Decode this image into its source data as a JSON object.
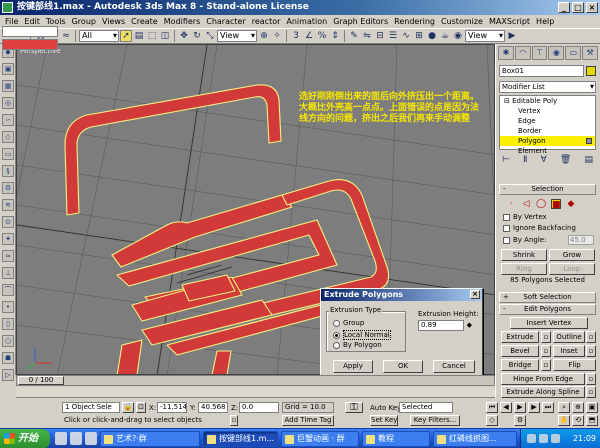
{
  "window": {
    "title": "按键部线1.max - Autodesk 3ds Max 8  - Stand-alone License"
  },
  "menu": [
    "File",
    "Edit",
    "Tools",
    "Group",
    "Views",
    "Create",
    "Modifiers",
    "Character",
    "reactor",
    "Animation",
    "Graph Editors",
    "Rendering",
    "Customize",
    "MAXScript",
    "Help"
  ],
  "toolbar": {
    "selection_filter": "All",
    "ref_coord": "View",
    "view_right": "View"
  },
  "viewport": {
    "label": "Perspective",
    "annotation": "选好刚刚倒出来的面后向外挤压出一个距离。 大概比外壳高一点点。上面错误的点是因为法线方向的问题，挤出之后我们再来手动调整"
  },
  "dialog": {
    "title": "Extrude Polygons",
    "group_title": "Extrusion Type",
    "options": [
      "Group",
      "Local Normal",
      "By Polygon"
    ],
    "selected_option": "Local Normal",
    "height_label": "Extrusion Height:",
    "height_value": "0.89",
    "buttons": {
      "apply": "Apply",
      "ok": "OK",
      "cancel": "Cancel"
    }
  },
  "command_panel": {
    "object_name": "Box01",
    "modifier_list": "Modifier List",
    "stack": {
      "root": "Editable Poly",
      "subs": [
        "Vertex",
        "Edge",
        "Border",
        "Polygon",
        "Element"
      ],
      "selected": "Polygon"
    },
    "selection": {
      "title": "Selection",
      "by_vertex": "By Vertex",
      "ignore_backfacing": "Ignore Backfacing",
      "by_angle": "By Angle:",
      "angle_value": "45.0",
      "shrink": "Shrink",
      "grow": "Grow",
      "ring": "Ring",
      "loop": "Loop",
      "status": "85 Polygons Selected"
    },
    "soft_selection": "Soft Selection",
    "edit_polygons": {
      "title": "Edit Polygons",
      "insert_vertex": "Insert Vertex",
      "extrude": "Extrude",
      "outline": "Outline",
      "bevel": "Bevel",
      "inset": "Inset",
      "bridge": "Bridge",
      "flip": "Flip",
      "hinge": "Hinge From Edge",
      "extrude_spline": "Extrude Along Spline"
    }
  },
  "timeline": {
    "position": "0 / 100"
  },
  "status": {
    "selection": "1 Object Sele",
    "x_label": "X:",
    "x": "-11.514",
    "y_label": "Y:",
    "y": "40.568",
    "z_label": "Z:",
    "z": "0.0",
    "grid": "Grid = 10.0",
    "prompt": "Click or click-and-drag to select objects",
    "add_time_tag": "Add Time Tag",
    "auto_key": "Auto Key",
    "key_mode": "Selected",
    "set_key": "Set Key",
    "key_filters": "Key Filters..."
  },
  "taskbar": {
    "start": "开始",
    "tasks": [
      "艺术?·群",
      "按键部线1.m...",
      "巨蟹动画 · 群",
      "教程",
      "红磷线抓图..."
    ],
    "clock": "21:09"
  },
  "colors": {
    "mesh_red": "#d23a3a",
    "selection_yellow": "#f8f000",
    "title_blue": "#0a246a"
  }
}
